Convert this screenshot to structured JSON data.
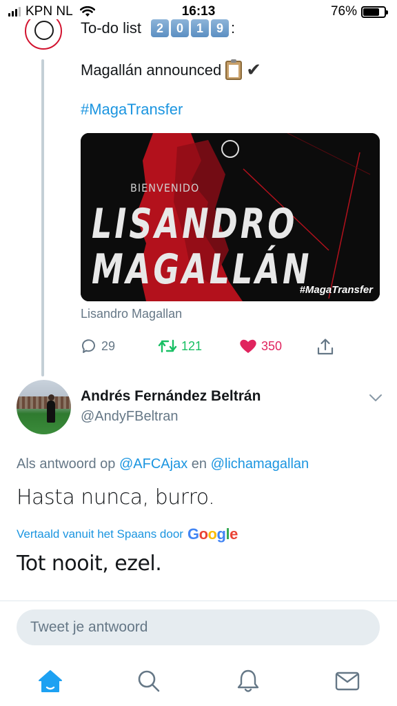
{
  "status_bar": {
    "carrier": "KPN NL",
    "time": "16:13",
    "battery": "76%",
    "battery_level": 0.76
  },
  "tweet1": {
    "line1_text": "To-do list",
    "year_digits": [
      "2",
      "0",
      "1",
      "9"
    ],
    "line1_suffix": ":",
    "line2_text": "Magallán announced",
    "hashtag": "#MagaTransfer",
    "card": {
      "kicker": "BIENVENIDO",
      "name_line1": "LISANDRO",
      "name_line2": "MAGALLÁN",
      "tag": "#MagaTransfer",
      "caption": "Lisandro Magallan"
    },
    "stats": {
      "replies": "29",
      "retweets": "121",
      "likes": "350"
    }
  },
  "tweet2": {
    "author_name": "Andrés Fernández Beltrán",
    "author_handle": "@AndyFBeltran",
    "reply_prefix": "Als antwoord op",
    "mention1": "@AFCAjax",
    "reply_and": "en",
    "mention2": "@lichamagallan",
    "body": "Hasta nunca, burro.",
    "translated_by": "Vertaald vanuit het Spaans door",
    "translation_provider": "Google",
    "translation": "Tot nooit, ezel."
  },
  "composer": {
    "placeholder": "Tweet je antwoord"
  },
  "tabbar": {
    "items": [
      "home-icon",
      "search-icon",
      "notifications-icon",
      "messages-icon"
    ],
    "active_color": "#1da1f2",
    "inactive_color": "#657786"
  },
  "colors": {
    "link": "#1b95e0",
    "retweet": "#17bf63",
    "like": "#e0245e"
  }
}
